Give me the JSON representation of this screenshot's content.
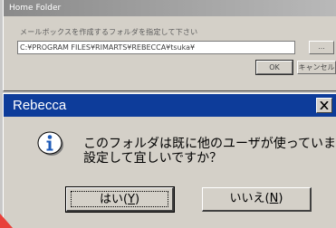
{
  "background_window": {
    "title": "Home Folder",
    "prompt": "メールボックスを作成するフォルダを指定して下さい",
    "path_value": "C:¥PROGRAM FILES¥RIMARTS¥REBECCA¥tsuka¥",
    "browse_label": "...",
    "ok_label": "OK",
    "cancel_label": "キャンセル"
  },
  "dialog": {
    "title": "Rebecca",
    "icon": "info-icon",
    "message_line1": "このフォルダは既に他のユーザが使っています",
    "message_line2": "設定して宜しいですか？",
    "yes_label_main": "はい(",
    "yes_mnemonic": "Y",
    "yes_label_end": ")",
    "no_label_main": "いいえ(",
    "no_mnemonic": "N",
    "no_label_end": ")"
  },
  "colors": {
    "title_bar": "#0d3c9a",
    "face": "#d4d0c8",
    "icon_blue": "#1e5bb8"
  }
}
